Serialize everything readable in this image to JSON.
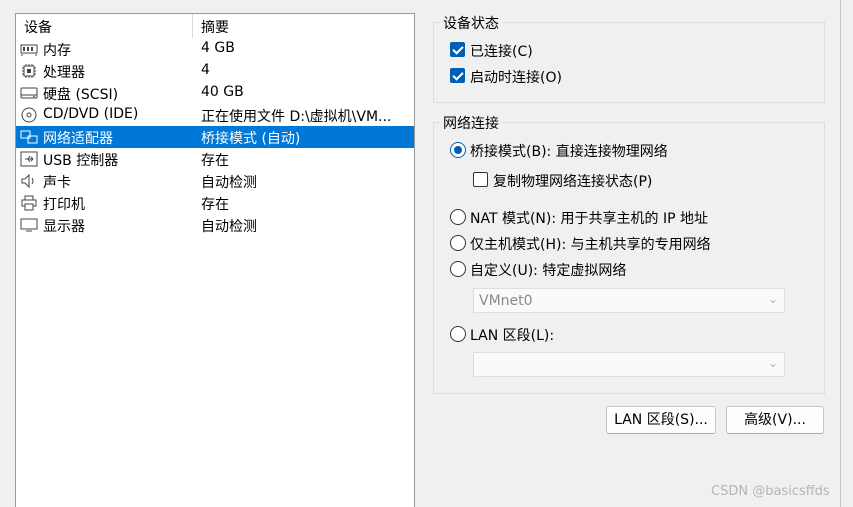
{
  "device_list": {
    "header": {
      "device": "设备",
      "summary": "摘要"
    },
    "rows": [
      {
        "icon": "memory-icon",
        "name": "内存",
        "summary": "4 GB",
        "selected": false
      },
      {
        "icon": "processor-icon",
        "name": "处理器",
        "summary": "4",
        "selected": false
      },
      {
        "icon": "hard-disk-icon",
        "name": "硬盘 (SCSI)",
        "summary": "40 GB",
        "selected": false
      },
      {
        "icon": "cd-dvd-icon",
        "name": "CD/DVD (IDE)",
        "summary": "正在使用文件 D:\\虚拟机\\VM...",
        "selected": false
      },
      {
        "icon": "network-adapter-icon",
        "name": "网络适配器",
        "summary": "桥接模式 (自动)",
        "selected": true
      },
      {
        "icon": "usb-controller-icon",
        "name": "USB 控制器",
        "summary": "存在",
        "selected": false
      },
      {
        "icon": "sound-card-icon",
        "name": "声卡",
        "summary": "自动检测",
        "selected": false
      },
      {
        "icon": "printer-icon",
        "name": "打印机",
        "summary": "存在",
        "selected": false
      },
      {
        "icon": "display-icon",
        "name": "显示器",
        "summary": "自动检测",
        "selected": false
      }
    ]
  },
  "device_status": {
    "title": "设备状态",
    "connected_label": "已连接(C)",
    "connected_checked": true,
    "connect_on_start_label": "启动时连接(O)",
    "connect_on_start_checked": true
  },
  "network_connection": {
    "title": "网络连接",
    "bridged_label": "桥接模式(B): 直接连接物理网络",
    "bridged_selected": true,
    "replicate_label": "复制物理网络连接状态(P)",
    "replicate_checked": false,
    "nat_label": "NAT 模式(N): 用于共享主机的 IP 地址",
    "host_only_label": "仅主机模式(H): 与主机共享的专用网络",
    "custom_label": "自定义(U): 特定虚拟网络",
    "custom_select_value": "VMnet0",
    "lan_segment_label": "LAN 区段(L):",
    "lan_segment_select_value": ""
  },
  "buttons": {
    "lan_segments": "LAN 区段(S)...",
    "advanced": "高级(V)..."
  },
  "watermark": "CSDN @basicsffds",
  "colors": {
    "selection": "#0078d7",
    "accent": "#005fb8"
  }
}
